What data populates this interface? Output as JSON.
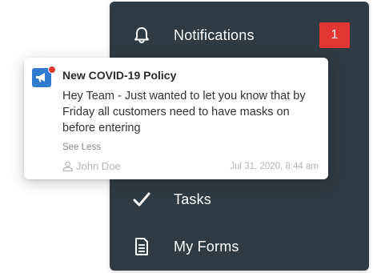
{
  "menu": {
    "notifications": {
      "label": "Notifications",
      "icon": "bell-icon",
      "badge": "1"
    },
    "tasks": {
      "label": "Tasks",
      "icon": "checkmark-icon"
    },
    "forms": {
      "label": "My Forms",
      "icon": "document-icon"
    }
  },
  "notification": {
    "icon": "megaphone-icon",
    "title": "New COVID-19 Policy",
    "body": "Hey Team - Just wanted to let you know that by Friday all customers need to have masks on before entering",
    "toggle_label": "See Less",
    "author": "John Doe",
    "timestamp": "Jul 31, 2020, 8:44 am"
  },
  "colors": {
    "menu_background": "#2f3b44",
    "badge": "#e23632",
    "notification_icon": "#2e7bcf",
    "unread_dot": "#e23632"
  }
}
